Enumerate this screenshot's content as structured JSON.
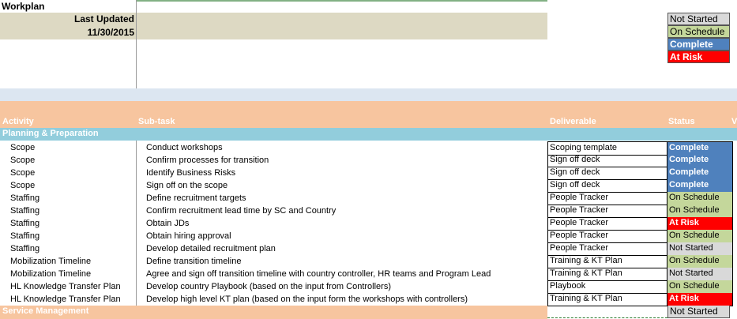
{
  "sheet": {
    "title": "Workplan",
    "last_updated_label": "Last Updated",
    "last_updated_date": "11/30/2015"
  },
  "legend": [
    {
      "label": "Not Started",
      "status": "ns"
    },
    {
      "label": "On Schedule",
      "status": "ok"
    },
    {
      "label": "Complete",
      "status": "done"
    },
    {
      "label": "At Risk",
      "status": "risk"
    }
  ],
  "headers": {
    "activity": "Activity",
    "subtask": "Sub-task",
    "deliverable": "Deliverable",
    "status": "Status",
    "overflow": "V"
  },
  "sections": {
    "planning": "Planning & Preparation",
    "service": "Service Management",
    "service_status": "Not Started"
  },
  "rows": [
    {
      "activity": "Scope",
      "subtask": "Conduct workshops",
      "deliverable": "Scoping template",
      "status": "Complete",
      "code": "done"
    },
    {
      "activity": "Scope",
      "subtask": "Confirm processes  for transition",
      "deliverable": "Sign off deck",
      "status": "Complete",
      "code": "done"
    },
    {
      "activity": "Scope",
      "subtask": "Identify Business Risks",
      "deliverable": "Sign off deck",
      "status": "Complete",
      "code": "done"
    },
    {
      "activity": "Scope",
      "subtask": "Sign off on the scope",
      "deliverable": "Sign off deck",
      "status": "Complete",
      "code": "done"
    },
    {
      "activity": "Staffing",
      "subtask": "Define recruitment targets",
      "deliverable": "People Tracker",
      "status": "On Schedule",
      "code": "ok"
    },
    {
      "activity": "Staffing",
      "subtask": "Confirm recruitment lead time by SC and Country",
      "deliverable": "People Tracker",
      "status": "On Schedule",
      "code": "ok"
    },
    {
      "activity": "Staffing",
      "subtask": "Obtain JDs",
      "deliverable": "People Tracker",
      "status": "At Risk",
      "code": "risk"
    },
    {
      "activity": "Staffing",
      "subtask": "Obtain hiring approval",
      "deliverable": "People Tracker",
      "status": "On Schedule",
      "code": "ok"
    },
    {
      "activity": "Staffing",
      "subtask": "Develop detailed recruitment plan",
      "deliverable": "People Tracker",
      "status": "Not Started",
      "code": "ns"
    },
    {
      "activity": "Mobilization Timeline",
      "subtask": "Define transition timeline",
      "deliverable": "Training & KT Plan",
      "status": "On Schedule",
      "code": "ok"
    },
    {
      "activity": "Mobilization Timeline",
      "subtask": "Agree and sign off transition timeline with country controller, HR teams and Program Lead",
      "deliverable": "Training & KT Plan",
      "status": "Not Started",
      "code": "ns"
    },
    {
      "activity": "HL Knowledge Transfer Plan",
      "subtask": "Develop country Playbook (based on the input from Controllers)",
      "deliverable": "Playbook",
      "status": "On Schedule",
      "code": "ok"
    },
    {
      "activity": "HL Knowledge Transfer Plan",
      "subtask": "Develop high level KT plan (based on the input form the workshops with controllers)",
      "deliverable": "Training & KT Plan",
      "status": "At Risk",
      "code": "risk"
    }
  ],
  "colors": {
    "complete": "#4f81bd",
    "on_schedule": "#c4d79b",
    "at_risk": "#ff0000",
    "not_started": "#d9d9d9",
    "header_band": "#f7c59f",
    "section_band": "#92cddc",
    "tan_band": "#ddd9c3"
  }
}
